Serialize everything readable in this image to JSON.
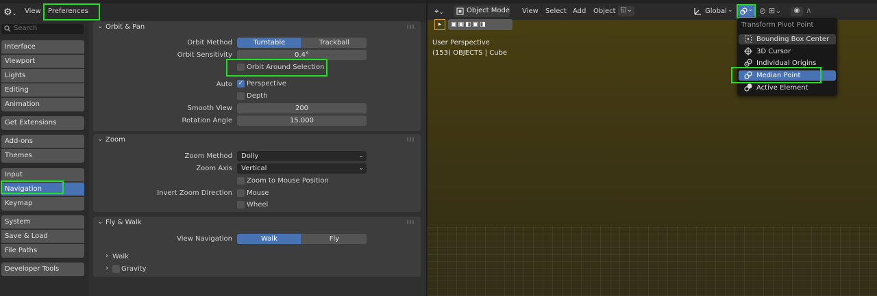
{
  "prefs_header": {
    "menu_view": "View",
    "menu_preferences": "Preferences"
  },
  "sidebar": {
    "search_placeholder": "Search",
    "items": [
      {
        "label": "Interface"
      },
      {
        "label": "Viewport"
      },
      {
        "label": "Lights"
      },
      {
        "label": "Editing"
      },
      {
        "label": "Animation"
      },
      {
        "label": "Get Extensions"
      },
      {
        "label": "Add-ons"
      },
      {
        "label": "Themes"
      },
      {
        "label": "Input"
      },
      {
        "label": "Navigation"
      },
      {
        "label": "Keymap"
      },
      {
        "label": "System"
      },
      {
        "label": "Save & Load"
      },
      {
        "label": "File Paths"
      },
      {
        "label": "Developer Tools"
      }
    ],
    "active": "Navigation"
  },
  "orbit_pan": {
    "title": "Orbit & Pan",
    "orbit_method_label": "Orbit Method",
    "orbit_method_options": [
      "Turntable",
      "Trackball"
    ],
    "orbit_method_selected": "Turntable",
    "orbit_sensitivity_label": "Orbit Sensitivity",
    "orbit_sensitivity_value": "0.4°",
    "orbit_around_selection_label": "Orbit Around Selection",
    "orbit_around_selection_checked": false,
    "auto_label": "Auto",
    "perspective_label": "Perspective",
    "perspective_checked": true,
    "depth_label": "Depth",
    "depth_checked": false,
    "smooth_view_label": "Smooth View",
    "smooth_view_value": "200",
    "rotation_angle_label": "Rotation Angle",
    "rotation_angle_value": "15.000"
  },
  "zoom": {
    "title": "Zoom",
    "zoom_method_label": "Zoom Method",
    "zoom_method_value": "Dolly",
    "zoom_axis_label": "Zoom Axis",
    "zoom_axis_value": "Vertical",
    "zoom_to_mouse_label": "Zoom to Mouse Position",
    "invert_label": "Invert Zoom Direction",
    "mouse_label": "Mouse",
    "wheel_label": "Wheel"
  },
  "fly_walk": {
    "title": "Fly & Walk",
    "view_navigation_label": "View Navigation",
    "options": [
      "Walk",
      "Fly"
    ],
    "selected": "Walk",
    "walk_label": "Walk",
    "gravity_label": "Gravity"
  },
  "viewport": {
    "mode": "Object Mode",
    "menus": [
      "View",
      "Select",
      "Add",
      "Object"
    ],
    "orientation": "Global",
    "perspective_text": "User Perspective",
    "collection_text": "(153) OBJECTS | Cube",
    "colors": {
      "bg_top": "#4a4012",
      "bg_bottom": "#332e17",
      "accent": "#4772b3",
      "highlight": "#22e022"
    }
  },
  "pivot_menu": {
    "title": "Transform Pivot Point",
    "items": [
      {
        "label": "Bounding Box Center",
        "icon": "bounding-box-icon"
      },
      {
        "label": "3D Cursor",
        "icon": "cursor-icon"
      },
      {
        "label": "Individual Origins",
        "icon": "individual-origins-icon"
      },
      {
        "label": "Median Point",
        "icon": "median-point-icon"
      },
      {
        "label": "Active Element",
        "icon": "active-element-icon"
      }
    ],
    "selected": "Median Point"
  }
}
